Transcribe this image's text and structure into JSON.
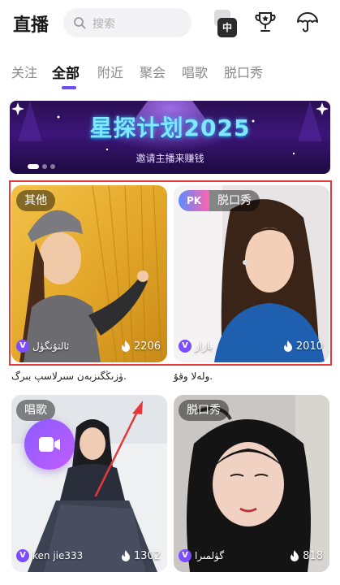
{
  "header": {
    "title": "直播",
    "search_placeholder": "搜索",
    "lang_badge": "中"
  },
  "tabs": [
    {
      "label": "关注",
      "active": false
    },
    {
      "label": "全部",
      "active": true
    },
    {
      "label": "附近",
      "active": false
    },
    {
      "label": "聚会",
      "active": false
    },
    {
      "label": "唱歌",
      "active": false
    },
    {
      "label": "脱口秀",
      "active": false
    }
  ],
  "banner": {
    "title": "星探计划2025",
    "subtitle": "邀请主播来赚钱",
    "page_count": 3,
    "active_page": 1
  },
  "cards": [
    {
      "tag": "其他",
      "pk": "",
      "streamer": "ئالتۇنگۈل",
      "viewers": "2206",
      "caption": "ۈزىڭگىزبەن سىرلاسپ بىرگ."
    },
    {
      "tag": "脱口秀",
      "pk": "PK",
      "streamer": "بازار",
      "viewers": "2010",
      "caption": "ولەلا وقۇ."
    },
    {
      "tag": "唱歌",
      "pk": "",
      "streamer": "ken jie333",
      "viewers": "1302",
      "caption": ""
    },
    {
      "tag": "脱口秀",
      "pk": "",
      "streamer": "گۈلمىرا",
      "viewers": "818",
      "caption": ""
    }
  ],
  "colors": {
    "accent": "#6a4cf0",
    "highlight_box": "#e5383b",
    "call_button": "#9b5cff"
  }
}
